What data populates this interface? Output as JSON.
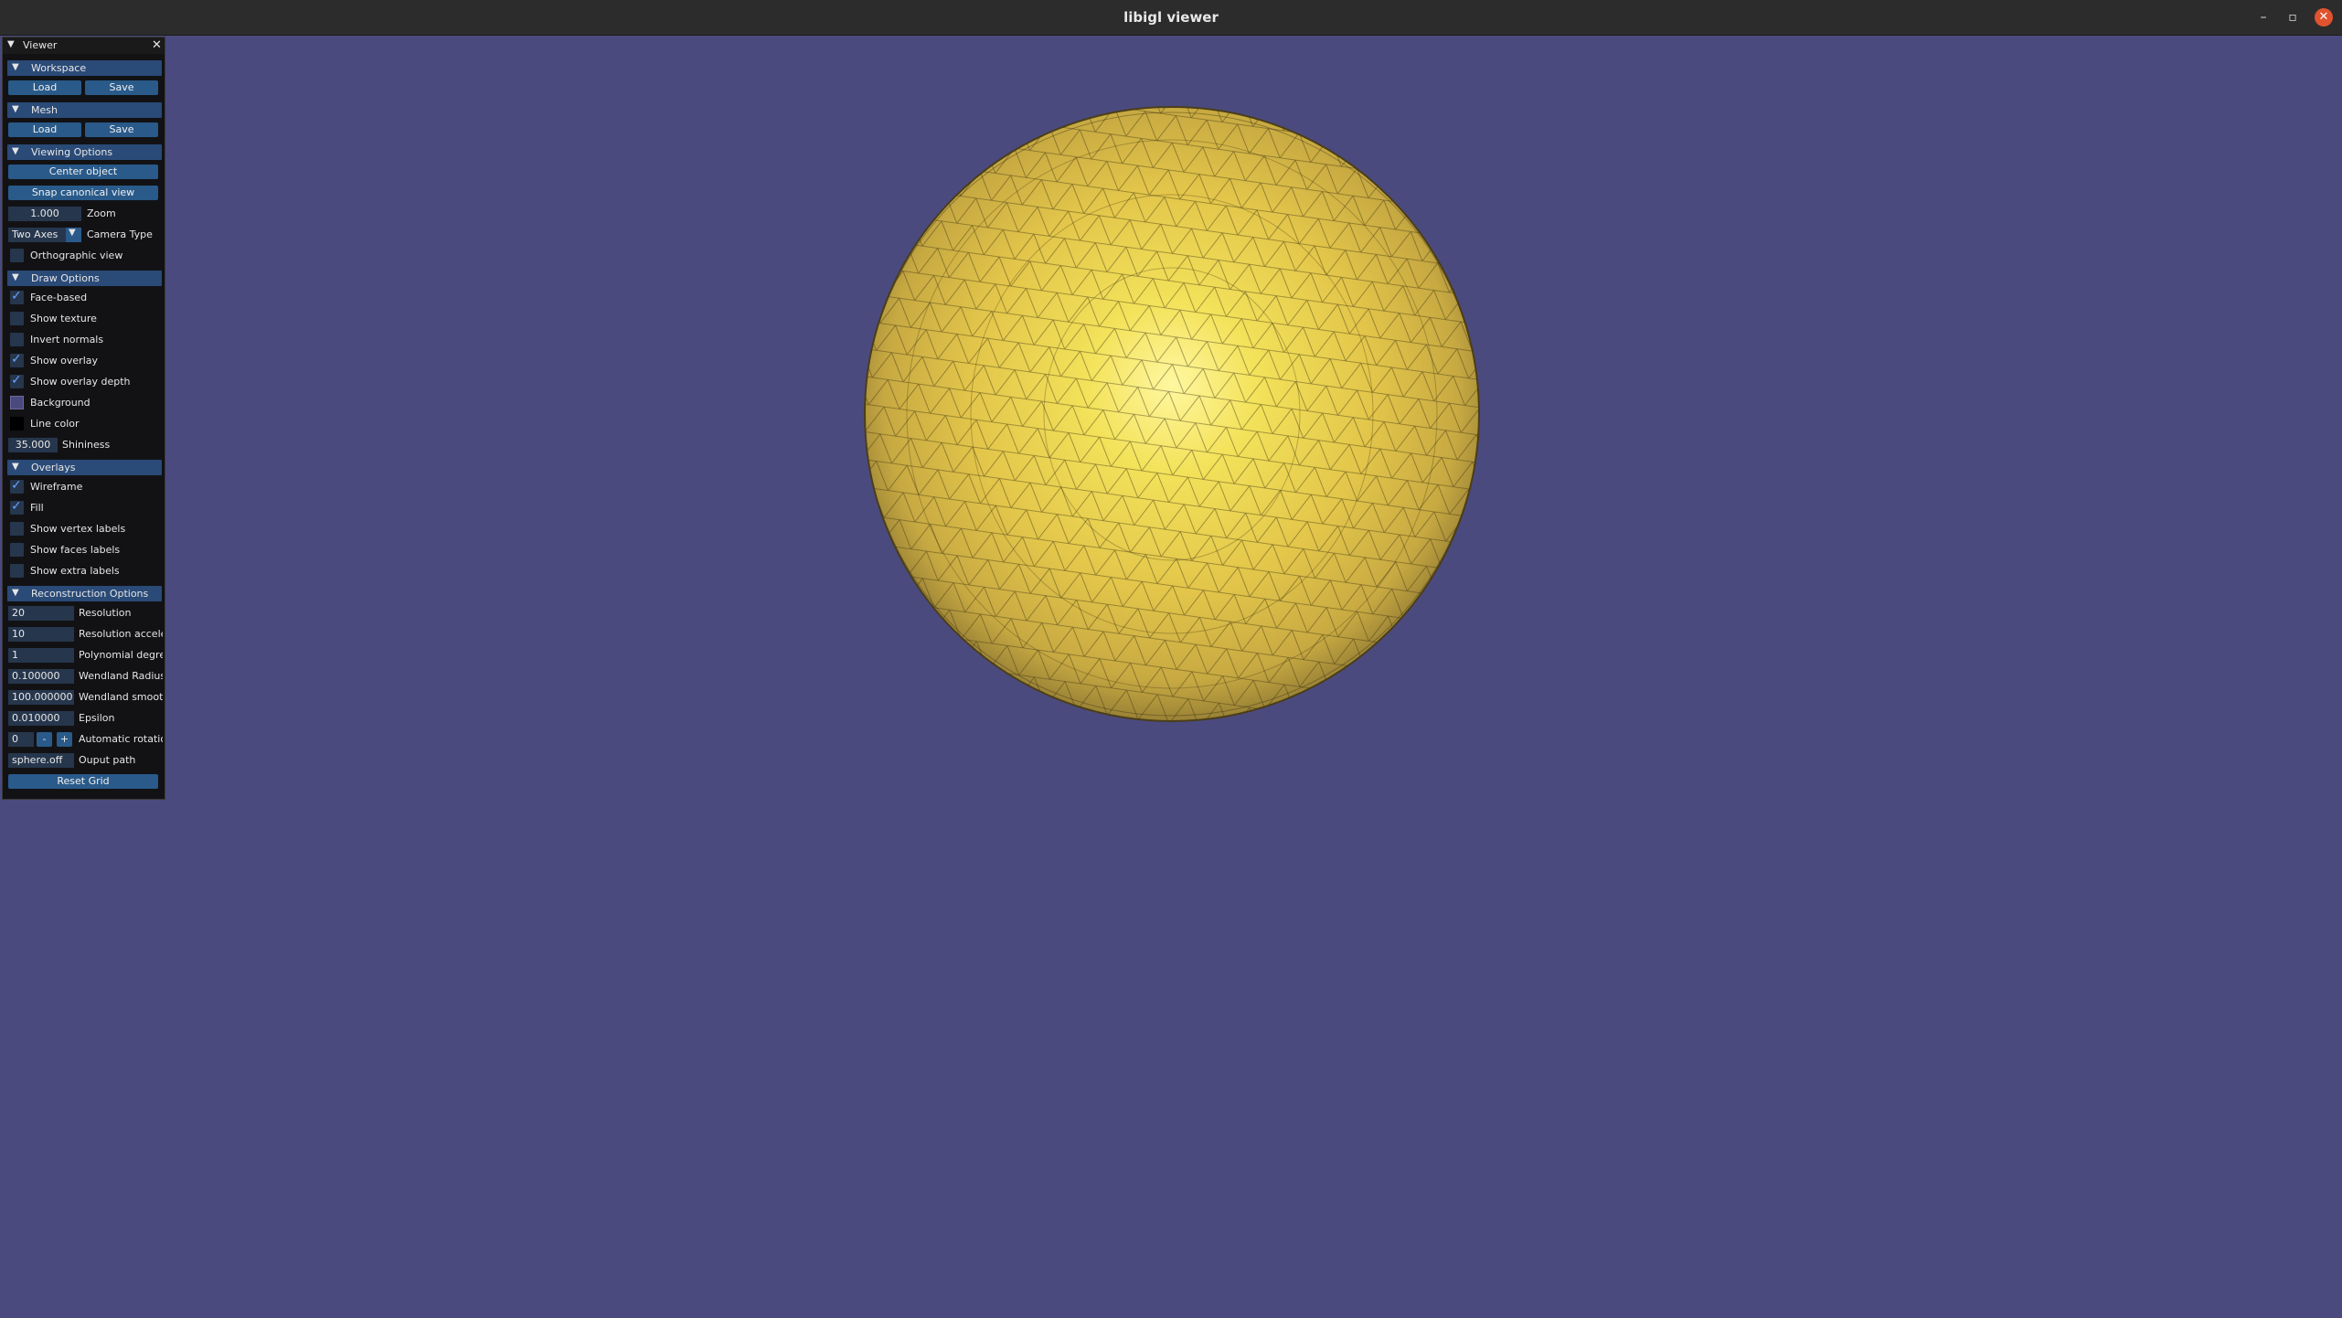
{
  "window": {
    "title": "libigl viewer",
    "minimize": "–",
    "maximize": "▫",
    "close": "✕"
  },
  "colors": {
    "background": "#4b4a7f",
    "mesh": "#e6c94a",
    "line": "#000000",
    "header": "#2a4a77",
    "button": "#295a8a"
  },
  "panel": {
    "title": "Viewer",
    "collapse_icon": "▼",
    "close_icon": "✕",
    "workspace": {
      "header": "Workspace",
      "load": "Load",
      "save": "Save"
    },
    "mesh": {
      "header": "Mesh",
      "load": "Load",
      "save": "Save"
    },
    "viewing": {
      "header": "Viewing Options",
      "center_object": "Center object",
      "snap_view": "Snap canonical view",
      "zoom_value": "1.000",
      "zoom_label": "Zoom",
      "camera_value": "Two Axes",
      "camera_label": "Camera Type",
      "orthographic": "Orthographic view"
    },
    "draw": {
      "header": "Draw Options",
      "face_based": "Face-based",
      "show_texture": "Show texture",
      "invert_normals": "Invert normals",
      "show_overlay": "Show overlay",
      "show_overlay_depth": "Show overlay depth",
      "background": "Background",
      "line_color": "Line color",
      "shininess_value": "35.000",
      "shininess_label": "Shininess"
    },
    "overlays": {
      "header": "Overlays",
      "wireframe": "Wireframe",
      "fill": "Fill",
      "vertex_labels": "Show vertex labels",
      "faces_labels": "Show faces labels",
      "extra_labels": "Show extra labels"
    },
    "reconstruction": {
      "header": "Reconstruction Options",
      "resolution_value": "20",
      "resolution_label": "Resolution",
      "res_accel_value": "10",
      "res_accel_label": "Resolution acceler",
      "poly_value": "1",
      "poly_label": "Polynomial degree",
      "wend_radius_value": "0.100000",
      "wend_radius_label": "Wendland Radius",
      "wend_smooth_value": "100.000000",
      "wend_smooth_label": "Wendland smooth",
      "epsilon_value": "0.010000",
      "epsilon_label": "Epsilon",
      "auto_rot_value": "0",
      "minus": "-",
      "plus": "+",
      "auto_rot_label": "Automatic rotatior",
      "output_value": "sphere.off",
      "output_label": "Ouput path",
      "reset_grid": "Reset Grid"
    }
  }
}
